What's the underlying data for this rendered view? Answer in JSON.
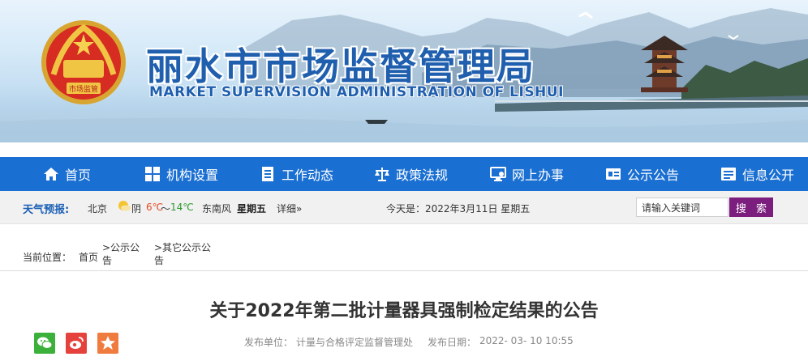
{
  "header": {
    "title_cn": "丽水市市场监督管理局",
    "title_en": "MARKET SUPERVISION ADMINISTRATION OF LISHUI",
    "emblem_text": "市场监管"
  },
  "nav": {
    "items": [
      {
        "label": "首页",
        "icon": "home-icon"
      },
      {
        "label": "机构设置",
        "icon": "grid-icon"
      },
      {
        "label": "工作动态",
        "icon": "document-icon"
      },
      {
        "label": "政策法规",
        "icon": "scales-icon"
      },
      {
        "label": "网上办事",
        "icon": "monitor-icon"
      },
      {
        "label": "公示公告",
        "icon": "id-card-icon"
      },
      {
        "label": "信息公开",
        "icon": "list-card-icon"
      }
    ]
  },
  "weather": {
    "label": "天气预报:",
    "city": "北京",
    "condition": "阴",
    "low": "6℃",
    "separator": "～",
    "high": "14℃",
    "wind": "东南风",
    "weekday": "星期五",
    "detail": "详细»",
    "today": "今天是：2022年3月11日 星期五"
  },
  "search": {
    "value": "请输入关键词",
    "button": "搜 索"
  },
  "breadcrumb": {
    "label": "当前位置：",
    "home": "首页",
    "level1": ">公示公告",
    "level2": ">其它公示公告"
  },
  "article": {
    "title": "关于2022年第二批计量器具强制检定结果的公告",
    "org_label": "发布单位：",
    "org": "计量与合格评定监督管理处",
    "date_label": "发布日期：",
    "date": "2022- 03- 10 10:55"
  },
  "colors": {
    "nav_bg": "#1a6fd2",
    "search_button": "#7b1e7e",
    "title_blue": "#1f5fae",
    "wechat": "#3bb13b",
    "weibo": "#e6423d",
    "qzone": "#f07b3f"
  }
}
